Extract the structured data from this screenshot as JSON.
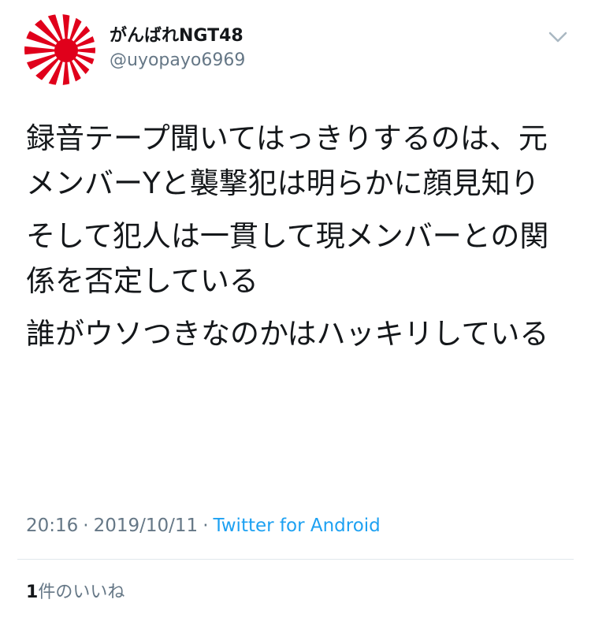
{
  "tweet": {
    "author": {
      "display_name": "がんばれNGT48",
      "username": "@uyopayo6969",
      "avatar_icon": "rising-sun-flag-icon",
      "avatar_colors": {
        "red": "#e0001b",
        "white": "#ffffff"
      }
    },
    "menu_icon": "chevron-down-icon",
    "paragraphs": [
      "録音テープ聞いてはっきりするのは、元メンバーYと襲撃犯は明らかに顔見知り",
      "そして犯人は一貫して現メンバーとの関係を否定している",
      "誰がウソつきなのかはハッキリしている"
    ],
    "time": "20:16",
    "separator": "·",
    "date": "2019/10/11",
    "source": "Twitter for Android",
    "likes": {
      "count": "1",
      "label": "件のいいね"
    }
  },
  "colors": {
    "text": "#14171a",
    "secondary": "#657786",
    "link": "#1da1f2",
    "divider": "#e1e8ed"
  }
}
